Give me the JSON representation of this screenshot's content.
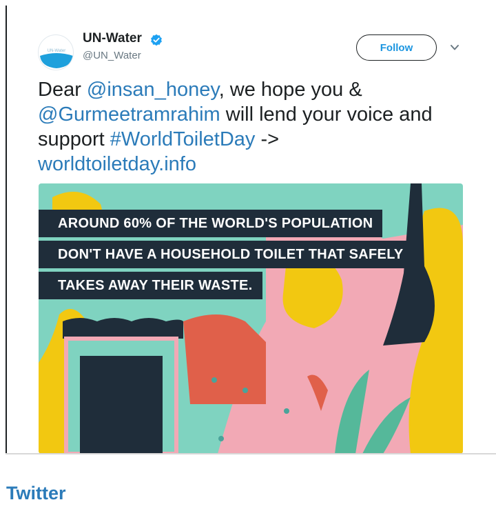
{
  "tweet": {
    "display_name": "UN-Water",
    "handle": "@UN_Water",
    "follow_label": "Follow",
    "avatar_text": "UN-Water",
    "text": {
      "line1_prefix": "Dear ",
      "mention1": "@insan_honey",
      "line1_suffix": ", we hope you &",
      "mention2": "@Gurmeetramrahim",
      "line2_suffix": " will lend your voice and",
      "line3_prefix": "support ",
      "hashtag": "#WorldToiletDay",
      "line3_suffix": " ->",
      "url": "worldtoiletday.info"
    },
    "media": {
      "banner_lines": [
        "AROUND 60% OF THE WORLD'S POPULATION",
        "DON'T HAVE A HOUSEHOLD TOILET THAT SAFELY",
        "TAKES AWAY THEIR WASTE."
      ]
    }
  },
  "footer": {
    "source_label": "Twitter"
  },
  "colors": {
    "link": "#2b7bb9",
    "follow_text": "#1b95e0",
    "verified": "#1da1f2",
    "banner_bg": "#1f2d3a",
    "illustration_mint": "#7fd3c0",
    "illustration_pink": "#f2a9b5",
    "illustration_yellow": "#f2c811",
    "illustration_navy": "#1f2d3a",
    "illustration_red": "#e0604a"
  },
  "icons": {
    "verified": "verified-badge-icon",
    "more": "chevron-down-icon"
  }
}
